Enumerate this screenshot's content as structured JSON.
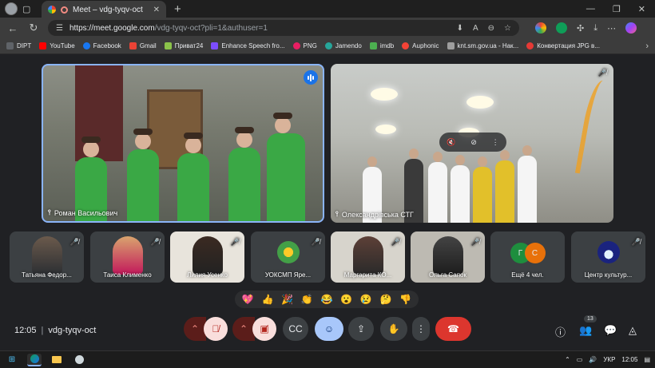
{
  "browser": {
    "tab_title": "Meet – vdg-tyqv-oct",
    "url_host": "https://meet.google.com",
    "url_path": "/vdg-tyqv-oct?pli=1&authuser=1",
    "bookmarks": [
      {
        "label": "DIPT",
        "color": "#5f6368"
      },
      {
        "label": "YouTube",
        "color": "#ff0000"
      },
      {
        "label": "Facebook",
        "color": "#1877f2"
      },
      {
        "label": "Gmail",
        "color": "#ea4335"
      },
      {
        "label": "Приват24",
        "color": "#8bc34a"
      },
      {
        "label": "Enhance Speech fro...",
        "color": "#7c4dff"
      },
      {
        "label": "PNG",
        "color": "#e91e63"
      },
      {
        "label": "Jamendo",
        "color": "#26a69a"
      },
      {
        "label": "imdb",
        "color": "#4caf50"
      },
      {
        "label": "Auphonic",
        "color": "#f44336"
      },
      {
        "label": "knt.sm.gov.ua - Нак...",
        "color": "#9e9e9e"
      },
      {
        "label": "Конвертация JPG в...",
        "color": "#e53935"
      }
    ]
  },
  "meet": {
    "main_tiles": [
      {
        "name": "Роман Васильович"
      },
      {
        "name": "Олександрівська СТГ"
      }
    ],
    "participants": [
      {
        "name": "Татьяна Федор..."
      },
      {
        "name": "Таиса Клименко"
      },
      {
        "name": "Лилия Усенко"
      },
      {
        "name": "УОКСМП Яре..."
      },
      {
        "name": "Маргарита КО..."
      },
      {
        "name": "Ольга Сапок"
      },
      {
        "name": "Ещё 4 чел.",
        "initials": [
          "Г",
          "С"
        ]
      },
      {
        "name": "Центр культур..."
      }
    ],
    "reactions": [
      "💖",
      "👍",
      "🎉",
      "👏",
      "😂",
      "😮",
      "😢",
      "🤔",
      "👎"
    ],
    "time": "12:05",
    "meeting_code": "vdg-tyqv-oct",
    "people_count": "13"
  },
  "taskbar": {
    "language": "УКР",
    "time": "12:05"
  }
}
